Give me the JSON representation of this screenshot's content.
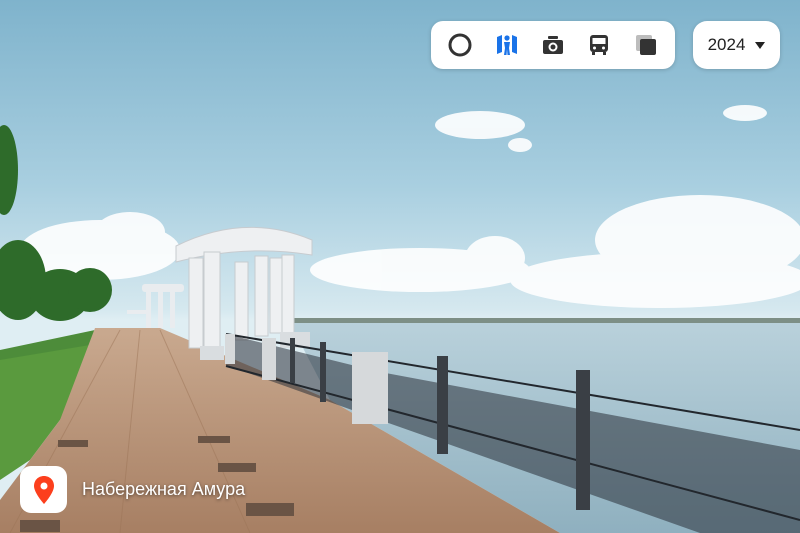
{
  "toolbar": {
    "tools": [
      {
        "icon": "circle-ring-icon",
        "active": false
      },
      {
        "icon": "pedestrian-panorama-icon",
        "active": true
      },
      {
        "icon": "camera-icon",
        "active": false
      },
      {
        "icon": "bus-icon",
        "active": false
      },
      {
        "icon": "layers-icon",
        "active": false
      }
    ],
    "accent_color": "#1a73e8"
  },
  "year_selector": {
    "value": "2024",
    "icon": "chevron-down-icon"
  },
  "location": {
    "icon": "map-pin-icon",
    "pin_color": "#fc3f1d",
    "name": "Набережная Амура"
  }
}
